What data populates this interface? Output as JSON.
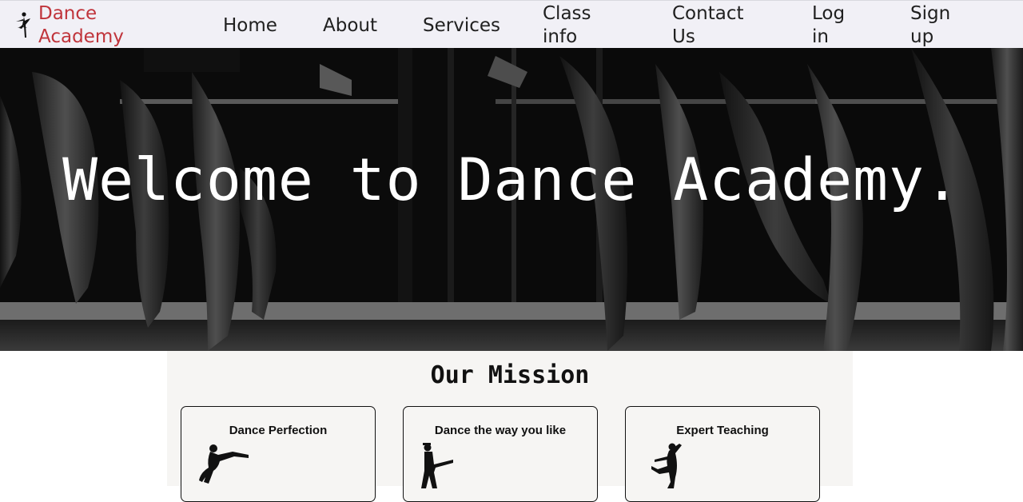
{
  "navbar": {
    "brand": "Dance Academy",
    "links": {
      "home": "Home",
      "about": "About",
      "services": "Services",
      "class_info": "Class info",
      "contact": "Contact Us",
      "login": "Log in",
      "signup": "Sign up"
    }
  },
  "hero": {
    "title": "Welcome to Dance Academy."
  },
  "mission": {
    "title": "Our Mission",
    "cards": [
      {
        "title": "Dance Perfection"
      },
      {
        "title": "Dance the way you like"
      },
      {
        "title": "Expert Teaching"
      }
    ]
  },
  "colors": {
    "brand": "#c0343b",
    "navbar_bg": "#f1f0f6",
    "mission_bg": "#f6f5f3"
  }
}
